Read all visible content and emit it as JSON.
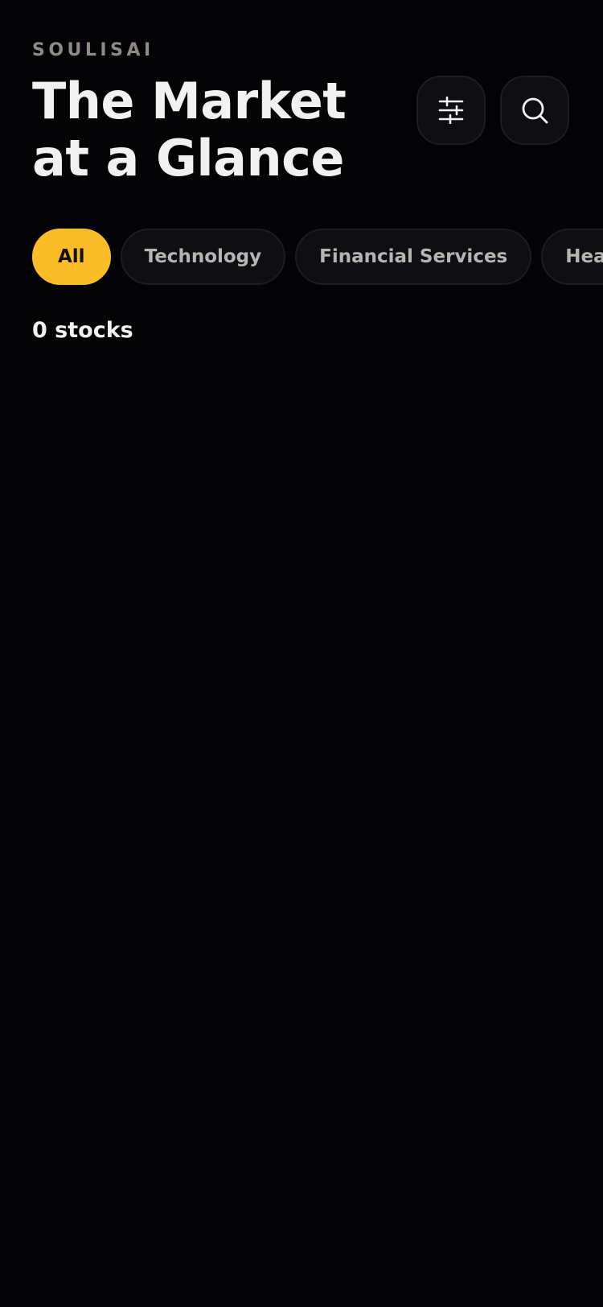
{
  "header": {
    "brand": "SOULISAI",
    "title_line1": "The Market",
    "title_line2": "at a Glance",
    "filter_icon": "sliders-icon",
    "search_icon": "search-icon"
  },
  "filters": {
    "chips": [
      {
        "label": "All",
        "active": true
      },
      {
        "label": "Technology",
        "active": false
      },
      {
        "label": "Financial Services",
        "active": false
      },
      {
        "label": "Health",
        "active": false
      }
    ]
  },
  "results": {
    "count_text": "0 stocks"
  },
  "colors": {
    "background": "#040406",
    "accent": "#fbbd27",
    "chip_background": "#0f0f13",
    "brand_text": "#8f8a83",
    "title_text": "#f2f1ef"
  }
}
